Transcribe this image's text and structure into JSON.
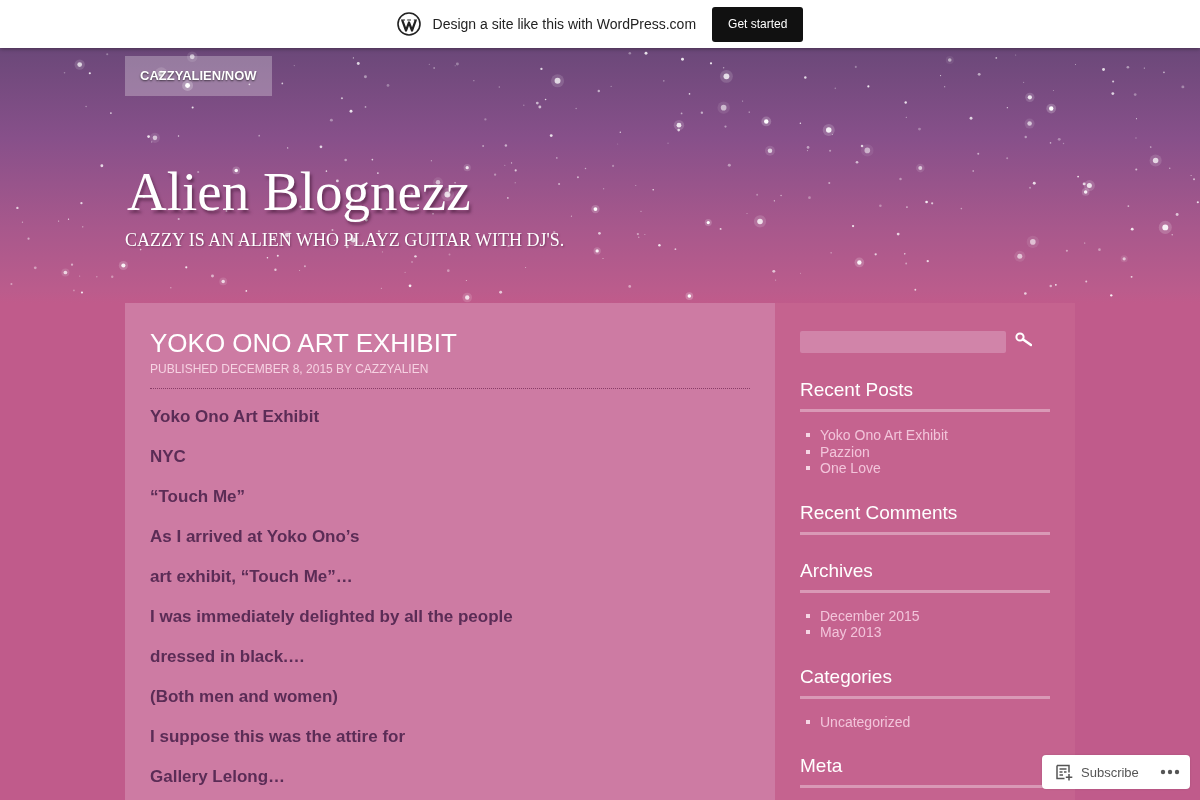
{
  "promo_bar": {
    "message": "Design a site like this with WordPress.com",
    "button": "Get started"
  },
  "header": {
    "menu_button": "CAZZYALIEN/NOW",
    "site_title": "Alien Blognezz",
    "tagline": "CAZZY IS AN ALIEN WHO PLAYZ GUITAR WITH DJ'S."
  },
  "post": {
    "title": "YOKO ONO ART EXHIBIT",
    "meta": "PUBLISHED DECEMBER 8, 2015 BY CAZZYALIEN",
    "paragraphs": [
      "Yoko Ono Art Exhibit",
      "NYC",
      "“Touch Me”",
      "As I arrived at Yoko Ono’s",
      "art exhibit, “Touch Me”…",
      "I was immediately delighted by all the people",
      "dressed in black.…",
      "(Both men and women)",
      "I suppose this was the attire for",
      "Gallery Lelong…"
    ]
  },
  "sidebar": {
    "widgets": [
      {
        "title": "Recent Posts",
        "items": [
          "Yoko Ono Art Exhibit",
          "Pazzion",
          "One Love"
        ]
      },
      {
        "title": "Recent Comments"
      },
      {
        "title": "Archives",
        "items": [
          "December 2015",
          "May 2013"
        ]
      },
      {
        "title": "Categories",
        "items": [
          "Uncategorized"
        ]
      },
      {
        "title": "Meta"
      }
    ]
  },
  "follow_bar": {
    "button": "Subscribe"
  }
}
